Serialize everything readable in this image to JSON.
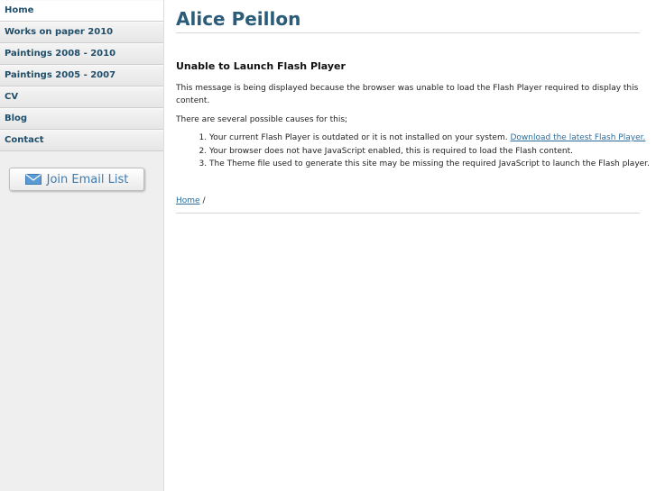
{
  "nav": {
    "items": [
      {
        "label": "Home"
      },
      {
        "label": "Works on paper 2010"
      },
      {
        "label": "Paintings 2008 - 2010"
      },
      {
        "label": "Paintings 2005 - 2007"
      },
      {
        "label": "CV"
      },
      {
        "label": "Blog"
      },
      {
        "label": "Contact"
      }
    ]
  },
  "email_button": {
    "label": "Join Email List",
    "icon": "envelope-icon"
  },
  "page": {
    "title": "Alice Peillon",
    "heading": "Unable to Launch Flash Player",
    "message": "This message is being displayed because the browser was unable to load the Flash Player required to display this content.",
    "causes_intro": "There are several possible causes for this;",
    "causes": [
      {
        "text": "Your current Flash Player is outdated or it is not installed on your system. ",
        "link": "Download the latest Flash Player."
      },
      {
        "text": "Your browser does not have JavaScript enabled, this is required to load the Flash content."
      },
      {
        "text": "The Theme file used to generate this site may be missing the required JavaScript to launch the Flash player."
      }
    ]
  },
  "breadcrumb": {
    "home": "Home",
    "separator": " /"
  },
  "colors": {
    "accent": "#2a5c7a",
    "link": "#2b6c9b",
    "sidebar": "#efefef"
  }
}
